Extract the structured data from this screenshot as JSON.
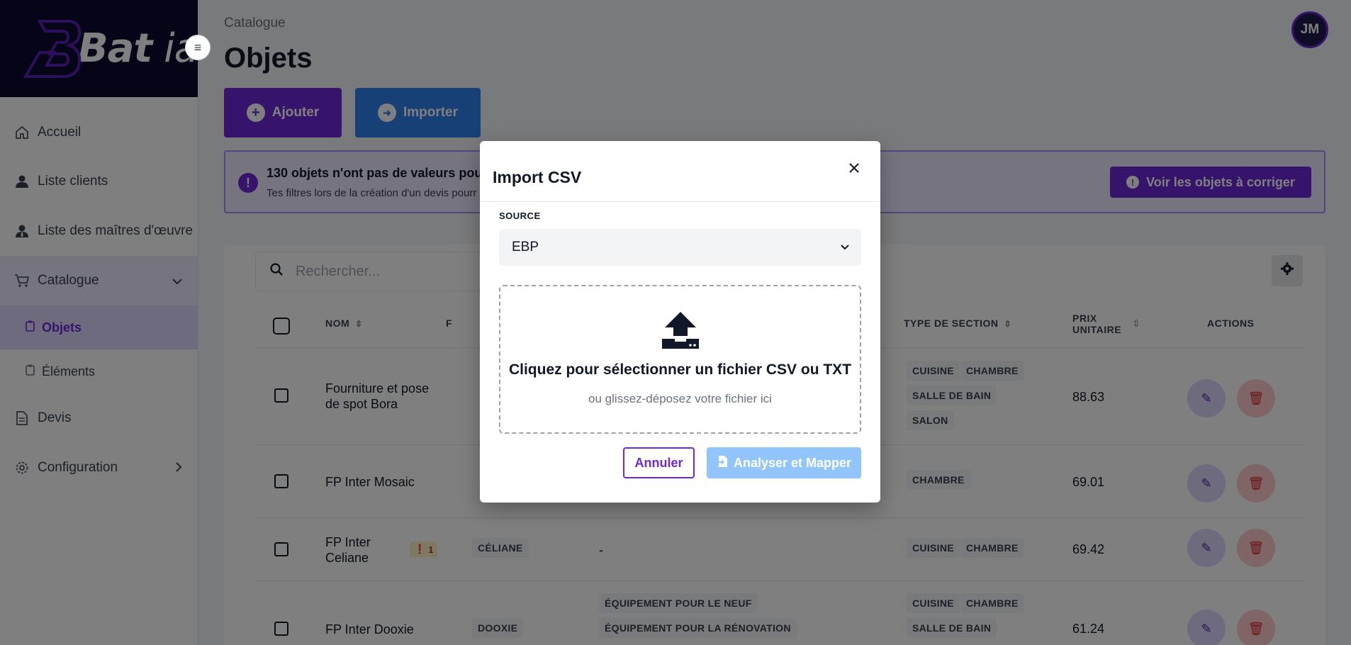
{
  "app": {
    "logo_bold": "Bat",
    "logo_light": "ia",
    "user_initials": "JM"
  },
  "sidebar": {
    "items": [
      {
        "label": "Accueil",
        "icon": "home-icon"
      },
      {
        "label": "Liste clients",
        "icon": "user-icon"
      },
      {
        "label": "Liste des maîtres d'œuvre",
        "icon": "user-tie-icon"
      },
      {
        "label": "Catalogue",
        "icon": "cart-icon"
      },
      {
        "label": "Devis",
        "icon": "document-icon"
      },
      {
        "label": "Configuration",
        "icon": "gear-icon"
      }
    ],
    "catalogue_sub": [
      {
        "label": "Objets",
        "icon": "clipboard-icon"
      },
      {
        "label": "Éléments",
        "icon": "clipboard-icon"
      }
    ]
  },
  "header": {
    "breadcrumb": "Catalogue",
    "title": "Objets"
  },
  "toolbar": {
    "add_label": "Ajouter",
    "import_label": "Importer"
  },
  "alert": {
    "title": "130 objets n'ont pas de valeurs pour",
    "subtitle": "Tes filtres lors de la création d'un devis pourr",
    "button_label": "Voir les objets à corriger"
  },
  "search": {
    "placeholder": "Rechercher..."
  },
  "table": {
    "headers": {
      "name": "NOM",
      "partial": "F",
      "section_type": "TYPE DE SECTION",
      "price_line1": "PRIX",
      "price_line2": "UNITAIRE",
      "actions": "ACTIONS"
    },
    "rows": [
      {
        "name_line1": "Fourniture et pose",
        "name_line2": "de spot Bora",
        "section_tags": [
          "CUISINE",
          "CHAMBRE",
          "SALLE DE BAIN",
          "SALON"
        ],
        "price": "88.63"
      },
      {
        "name_line1": "FP Inter Mosaic",
        "name_line2": "",
        "section_tags": [
          "CHAMBRE"
        ],
        "price": "69.01"
      },
      {
        "name_line1": "FP Inter",
        "name_line2": "Celiane",
        "badge": "1",
        "family_tag": "CÉLIANE",
        "middle": "-",
        "section_tags": [
          "CUISINE",
          "CHAMBRE"
        ],
        "price": "69.42"
      },
      {
        "name_line1": "FP Inter Dooxie",
        "name_line2": "",
        "family_tag": "DOOXIE",
        "middle_tags": [
          "ÉQUIPEMENT POUR LE NEUF",
          "ÉQUIPEMENT POUR LA RÉNOVATION"
        ],
        "section_tags": [
          "CUISINE",
          "CHAMBRE",
          "SALLE DE BAIN"
        ],
        "price": "61.24"
      }
    ]
  },
  "modal": {
    "title": "Import CSV",
    "source_label": "SOURCE",
    "source_value": "EBP",
    "dropzone_main": "Cliquez pour sélectionner un fichier CSV ou TXT",
    "dropzone_sub": "ou glissez-déposez votre fichier ici",
    "cancel_label": "Annuler",
    "analyze_label": "Analyser et Mapper"
  }
}
